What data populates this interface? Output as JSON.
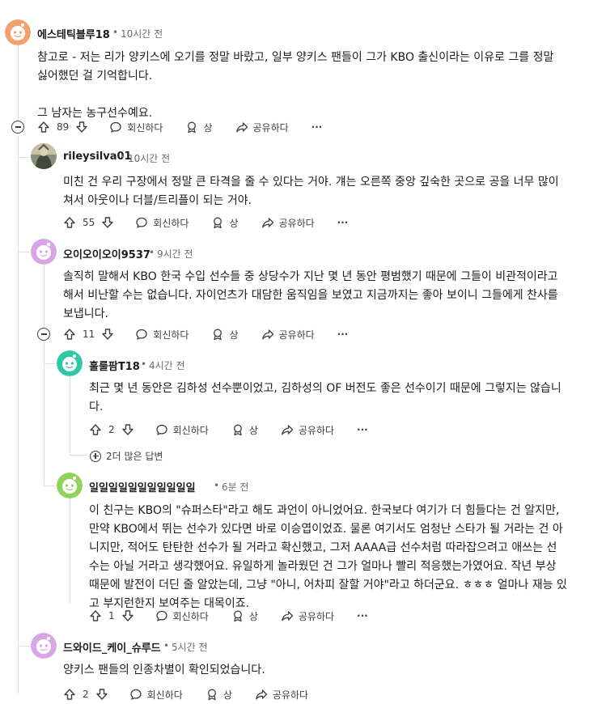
{
  "comments": [
    {
      "author": "에스테틱블루18",
      "time": "10시간 전",
      "body": [
        "참고로 - 저는 리가 양키스에 오기를 정말 바랐고, 일부 양키스 팬들이 그가 KBO 출신이라는 이유로 그를 정말",
        "싫어했던 걸 기억합니다.",
        "",
        "그 남자는 농구선수예요."
      ],
      "votes": "89"
    },
    {
      "author": "rileysilva01",
      "time": "10시간 전",
      "body": [
        "미친 건 우리 구장에서 정말 큰 타격을 줄 수 있다는 거야. 걔는 오른쪽 중앙 깊숙한 곳으로 공을 너무 많이",
        "쳐서 아웃이나 더블/트리플이 되는 거야."
      ],
      "votes": "55"
    },
    {
      "author": "오이오이오이9537",
      "time": "9시간 전",
      "body": [
        "솔직히 말해서 KBO 한국 수입 선수들 중 상당수가 지난 몇 년 동안 평범했기 때문에 그들이 비관적이라고",
        "해서 비난할 수는 없습니다. 자이언츠가 대담한 움직임을 보였고 지금까지는 좋아 보이니 그들에게 찬사를",
        "보냅니다."
      ],
      "votes": "11"
    },
    {
      "author": "훌룰팜T18",
      "time": "4시간 전",
      "body": [
        "최근 몇 년 동안은 김하성 선수뿐이었고, 김하성의 OF 버전도 좋은 선수이기 때문에 그렇지는 않습니",
        "다."
      ],
      "votes": "2"
    },
    {
      "author": "일일일일일일일일일일일",
      "time": "6분 전",
      "body": [
        "이 친구는 KBO의 \"슈퍼스타\"라고 해도 과언이 아니었어요. 한국보다 여기가 더 힘들다는 건 알지만,",
        "만약 KBO에서 뛰는 선수가 있다면 바로 이승엽이었죠. 물론 여기서도 엄청난 스타가 될 거라는 건 아",
        "니지만, 적어도 탄탄한 선수가 될 거라고 확신했고, 그저 AAAA급 선수처럼 따라잡으려고 애쓰는 선",
        "수는 아닐 거라고 생각했어요. 유일하게 놀라웠던 건 그가 얼마나 빨리 적응했는가였어요. 작년 부상",
        "때문에 발전이 더딘 줄 알았는데, 그냥 \"아니, 어차피 잘할 거야\"라고 하더군요. ㅎㅎㅎ 얼마나 재능 있",
        "고 부지런한지 보여주는 대목이죠."
      ],
      "votes": "1"
    },
    {
      "author": "드와이드_케이_슈루드",
      "time": "5시간 전",
      "body": [
        "양키스 팬들의 인종차별이 확인되었습니다."
      ],
      "votes": "2"
    }
  ],
  "actions": {
    "reply": "회신하다",
    "award": "상",
    "share": "공유하다",
    "more": "···"
  },
  "more_replies": "2더 많은 답변",
  "separator": "•",
  "colors": {
    "orange_avatar": "#f4a26b",
    "pink_avatar": "#d8a6e6",
    "teal_avatar": "#2fc7a8",
    "green_avatar": "#8fd45a",
    "thread_line": "#dcdfe2"
  }
}
